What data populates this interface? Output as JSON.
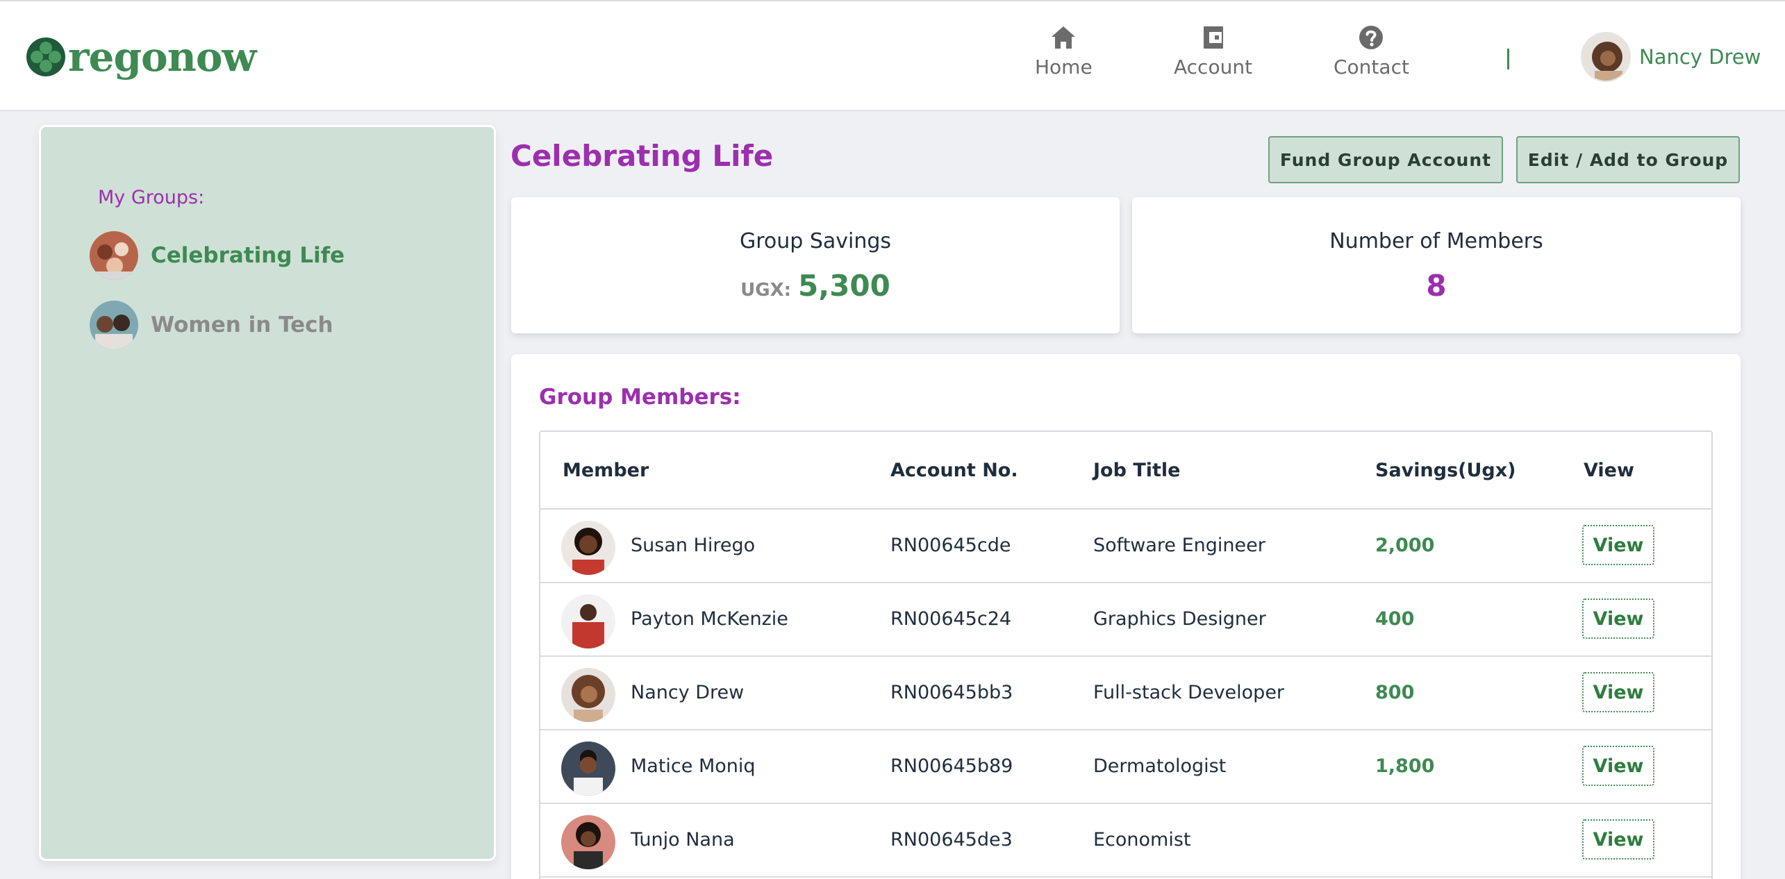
{
  "brand": {
    "name": "regonow"
  },
  "nav": {
    "items": [
      {
        "label": "Home",
        "icon": "home-icon"
      },
      {
        "label": "Account",
        "icon": "wallet-icon"
      },
      {
        "label": "Contact",
        "icon": "help-icon"
      }
    ],
    "user": {
      "name": "Nancy Drew"
    }
  },
  "sidebar": {
    "heading": "My Groups:",
    "groups": [
      {
        "label": "Celebrating Life",
        "active": true
      },
      {
        "label": "Women in Tech",
        "active": false
      }
    ]
  },
  "main": {
    "title": "Celebrating Life",
    "buttons": {
      "fund": "Fund Group Account",
      "edit": "Edit / Add to Group"
    },
    "savings_card": {
      "title": "Group Savings",
      "currency": "UGX:",
      "amount": "5,300"
    },
    "members_card": {
      "title": "Number of Members",
      "count": "8"
    },
    "members_heading": "Group Members:",
    "table": {
      "headers": [
        "Member",
        "Account No.",
        "Job Title",
        "Savings(Ugx)",
        "View"
      ],
      "rows": [
        {
          "name": "Susan Hirego",
          "account": "RN00645cde",
          "job": "Software Engineer",
          "savings": "2,000",
          "view": "View"
        },
        {
          "name": "Payton McKenzie",
          "account": "RN00645c24",
          "job": "Graphics Designer",
          "savings": "400",
          "view": "View"
        },
        {
          "name": "Nancy Drew",
          "account": "RN00645bb3",
          "job": "Full-stack Developer",
          "savings": "800",
          "view": "View"
        },
        {
          "name": "Matice Moniq",
          "account": "RN00645b89",
          "job": "Dermatologist",
          "savings": "1,800",
          "view": "View"
        },
        {
          "name": "Tunjo Nana",
          "account": "RN00645de3",
          "job": "Economist",
          "savings": "",
          "view": "View"
        }
      ]
    }
  },
  "colors": {
    "brand_green": "#3e8a52",
    "accent_purple": "#9c2fae",
    "sidebar_bg": "#cfe0d6",
    "page_bg": "#eff0f4"
  }
}
